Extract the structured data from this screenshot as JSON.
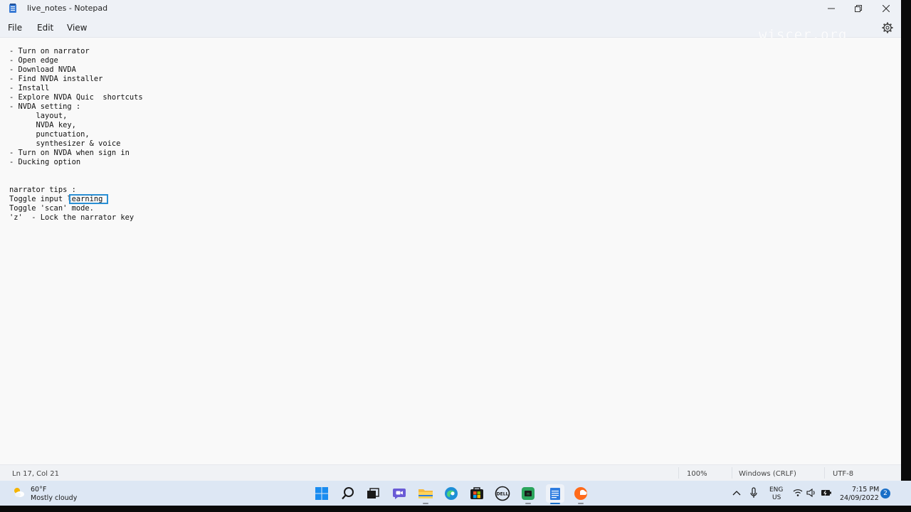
{
  "window": {
    "title": "live_notes - Notepad"
  },
  "menu": {
    "file": "File",
    "edit": "Edit",
    "view": "View"
  },
  "watermark": "wiscer.org",
  "editor": {
    "lines": [
      "- Turn on narrator",
      "- Open edge",
      "- Download NVDA",
      "- Find NVDA installer",
      "- Install",
      "- Explore NVDA Quic  shortcuts",
      "- NVDA setting :",
      "      layout,",
      "      NVDA key,",
      "      punctuation,",
      "      synthesizer & voice",
      "- Turn on NVDA when sign in",
      "- Ducking option",
      "",
      "",
      "narrator tips :",
      "Toggle input learning",
      "Toggle 'scan' mode.",
      "'z'  - Lock the narrator key"
    ],
    "selected_text": "learning"
  },
  "status": {
    "position": "Ln 17, Col 21",
    "zoom": "100%",
    "line_endings": "Windows (CRLF)",
    "encoding": "UTF-8"
  },
  "taskbar": {
    "weather_temp": "60°F",
    "weather_desc": "Mostly cloudy",
    "icons": [
      "start-icon",
      "search-icon",
      "task-view-icon",
      "chat-icon",
      "file-explorer-icon",
      "edge-icon",
      "store-icon",
      "dell-icon",
      "terminal-app-icon",
      "notepad-icon",
      "soundcloud-icon"
    ],
    "lang_line1": "ENG",
    "lang_line2": "US",
    "time": "7:15 PM",
    "date": "24/09/2022",
    "notification_count": "2"
  },
  "colors": {
    "accent": "#1a6fc7",
    "selection_border": "#2a8fd4",
    "taskbar_bg": "#dde7f4"
  }
}
